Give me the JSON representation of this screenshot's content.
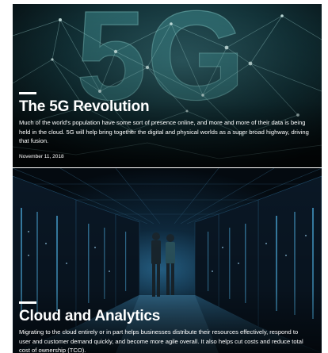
{
  "articles": [
    {
      "title": "The 5G Revolution",
      "description": "Much of the world's population have some sort of presence online, and more and more of their data is being held in the cloud. 5G will help bring together the digital and physical worlds as a super broad highway, driving that fusion.",
      "date": "November 11, 2018",
      "image_text": "5G"
    },
    {
      "title": "Cloud and Analytics",
      "description": "Migrating to the cloud entirely or in part helps businesses distribute their resources effectively, respond to user and customer demand quickly, and become more agile overall. It also helps cut costs and reduce total cost of ownership (TCO)."
    }
  ],
  "colors": {
    "card_5g_bg": "#0a1e24",
    "card_cloud_bg": "#061019",
    "text": "#ffffff",
    "server_light": "#4fb3e8"
  }
}
